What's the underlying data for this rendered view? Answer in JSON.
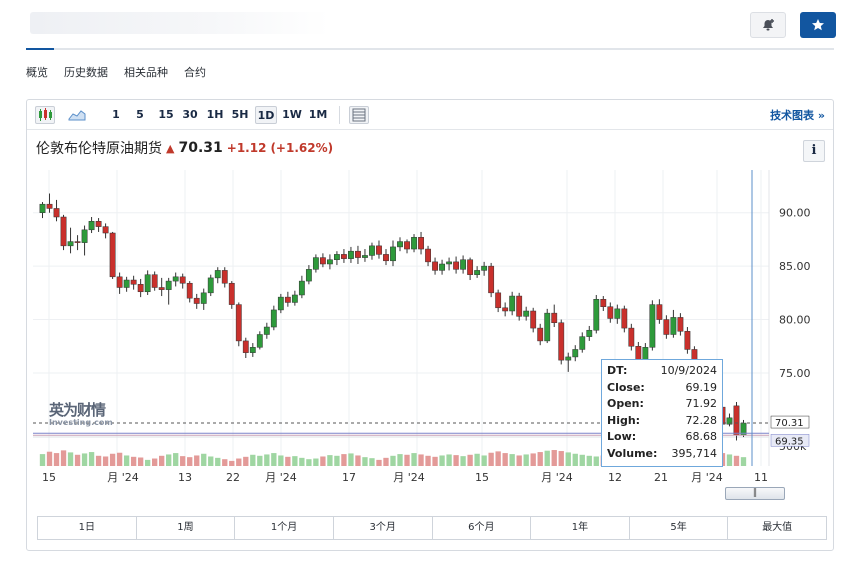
{
  "header": {
    "alert_icon": "bell-plus-icon",
    "star_icon": "star-icon"
  },
  "subnav": {
    "items": [
      "概览",
      "历史数据",
      "相关品种",
      "合约"
    ]
  },
  "toolbar": {
    "chart_type_icon": "candlestick-icon",
    "area_icon": "area-chart-icon",
    "intervals": [
      "1",
      "5",
      "15",
      "30",
      "1H",
      "5H",
      "1D",
      "1W",
      "1M"
    ],
    "selected_interval": "1D",
    "settings_icon": "grid-settings-icon",
    "tech_chart_label": "技术图表 »"
  },
  "instrument": {
    "name": "伦敦布伦特原油期货",
    "price": "70.31",
    "change": "+1.12",
    "change_pct": "(+1.62%)"
  },
  "info_button": "i",
  "logo": {
    "cn": "英为财情",
    "en": "Investing.com"
  },
  "tooltip": {
    "rows": [
      {
        "label": "DT:",
        "value": "10/9/2024"
      },
      {
        "label": "Close:",
        "value": "69.19"
      },
      {
        "label": "Open:",
        "value": "71.92"
      },
      {
        "label": "High:",
        "value": "72.28"
      },
      {
        "label": "Low:",
        "value": "68.68"
      },
      {
        "label": "Volume:",
        "value": "395,714"
      }
    ]
  },
  "range_buttons": [
    "1日",
    "1周",
    "1个月",
    "3个月",
    "6个月",
    "1年",
    "5年",
    "最大值"
  ],
  "colors": {
    "up": "#2e9a3b",
    "down": "#c9302c",
    "accent": "#1256a0"
  },
  "chart_data": {
    "type": "candlestick",
    "y_ticks": [
      "90.00",
      "85.00",
      "80.00",
      "75.00"
    ],
    "volume_tick": "500k",
    "last_price_label": "70.31",
    "ref_price_label": "69.35",
    "x_labels": [
      "15",
      "月 '24",
      "13",
      "22",
      "月 '24",
      "17",
      "月 '24",
      "15",
      "月 '24",
      "12",
      "21",
      "月 '24",
      "11"
    ],
    "ylim": [
      72,
      94
    ],
    "candles": [
      [
        90.0,
        90.8,
        91.0,
        89.5
      ],
      [
        90.8,
        90.4,
        91.8,
        90.0
      ],
      [
        90.4,
        89.6,
        91.2,
        89.2
      ],
      [
        89.6,
        86.9,
        89.8,
        86.5
      ],
      [
        86.9,
        87.3,
        88.6,
        86.2
      ],
      [
        87.3,
        87.2,
        87.9,
        86.5
      ],
      [
        87.2,
        88.4,
        88.8,
        86.0
      ],
      [
        88.4,
        89.2,
        89.6,
        88.1
      ],
      [
        89.2,
        88.7,
        89.5,
        88.2
      ],
      [
        88.7,
        88.1,
        89.0,
        87.6
      ],
      [
        88.1,
        84.0,
        88.2,
        83.8
      ],
      [
        84.0,
        83.0,
        84.4,
        82.4
      ],
      [
        83.0,
        83.7,
        84.0,
        82.6
      ],
      [
        83.7,
        83.3,
        84.1,
        82.8
      ],
      [
        83.3,
        82.6,
        83.8,
        82.1
      ],
      [
        82.6,
        84.2,
        84.6,
        82.3
      ],
      [
        84.2,
        83.0,
        84.5,
        82.7
      ],
      [
        83.0,
        82.8,
        83.9,
        82.2
      ],
      [
        82.8,
        83.6,
        83.9,
        81.4
      ],
      [
        83.6,
        84.0,
        84.4,
        83.1
      ],
      [
        84.0,
        83.4,
        84.3,
        82.9
      ],
      [
        83.4,
        82.0,
        83.6,
        81.6
      ],
      [
        82.0,
        81.5,
        82.4,
        81.0
      ],
      [
        81.5,
        82.5,
        82.9,
        80.9
      ],
      [
        82.5,
        83.9,
        84.2,
        82.2
      ],
      [
        83.9,
        84.6,
        84.9,
        83.4
      ],
      [
        84.6,
        83.4,
        84.9,
        83.0
      ],
      [
        83.4,
        81.4,
        83.6,
        81.0
      ],
      [
        81.4,
        78.0,
        81.6,
        77.5
      ],
      [
        78.0,
        76.9,
        78.3,
        76.4
      ],
      [
        76.9,
        77.4,
        77.8,
        76.5
      ],
      [
        77.4,
        78.6,
        78.9,
        77.2
      ],
      [
        78.6,
        79.3,
        79.7,
        78.2
      ],
      [
        79.3,
        80.9,
        81.3,
        79.0
      ],
      [
        80.9,
        82.1,
        82.4,
        80.6
      ],
      [
        82.1,
        81.6,
        82.6,
        81.2
      ],
      [
        81.6,
        82.3,
        82.7,
        81.3
      ],
      [
        82.3,
        83.6,
        84.1,
        82.0
      ],
      [
        83.6,
        84.7,
        85.1,
        83.3
      ],
      [
        84.7,
        85.8,
        86.1,
        84.4
      ],
      [
        85.8,
        85.2,
        86.2,
        84.9
      ],
      [
        85.2,
        85.6,
        86.1,
        84.7
      ],
      [
        85.6,
        86.1,
        86.4,
        85.1
      ],
      [
        86.1,
        85.7,
        86.6,
        85.3
      ],
      [
        85.7,
        86.4,
        86.8,
        85.3
      ],
      [
        86.4,
        85.8,
        86.9,
        85.2
      ],
      [
        85.8,
        86.0,
        86.6,
        85.4
      ],
      [
        86.0,
        86.9,
        87.2,
        85.6
      ],
      [
        86.9,
        86.1,
        87.4,
        85.7
      ],
      [
        86.1,
        85.5,
        86.6,
        85.1
      ],
      [
        85.5,
        86.8,
        87.4,
        85.0
      ],
      [
        86.8,
        87.3,
        87.7,
        86.4
      ],
      [
        87.3,
        86.6,
        87.5,
        86.2
      ],
      [
        86.6,
        87.7,
        88.0,
        86.3
      ],
      [
        87.7,
        86.6,
        88.2,
        86.1
      ],
      [
        86.6,
        85.4,
        86.9,
        85.0
      ],
      [
        85.4,
        84.6,
        85.8,
        84.2
      ],
      [
        84.6,
        85.2,
        85.6,
        84.2
      ],
      [
        85.2,
        85.4,
        85.8,
        84.6
      ],
      [
        85.4,
        84.7,
        85.9,
        84.3
      ],
      [
        84.7,
        85.6,
        86.0,
        84.3
      ],
      [
        85.6,
        84.2,
        85.8,
        83.7
      ],
      [
        84.2,
        84.6,
        85.0,
        83.9
      ],
      [
        84.6,
        85.0,
        85.4,
        84.1
      ],
      [
        85.0,
        82.5,
        85.3,
        82.1
      ],
      [
        82.5,
        81.1,
        82.8,
        80.7
      ],
      [
        81.1,
        80.8,
        81.6,
        80.3
      ],
      [
        80.8,
        82.2,
        82.6,
        80.4
      ],
      [
        82.2,
        80.3,
        82.5,
        79.9
      ],
      [
        80.3,
        80.8,
        81.2,
        79.9
      ],
      [
        80.8,
        79.2,
        81.1,
        78.8
      ],
      [
        79.2,
        78.0,
        79.6,
        77.6
      ],
      [
        78.0,
        80.6,
        81.0,
        77.8
      ],
      [
        80.6,
        79.7,
        81.4,
        79.3
      ],
      [
        79.7,
        76.2,
        80.0,
        75.8
      ],
      [
        76.2,
        76.5,
        76.9,
        75.1
      ],
      [
        76.5,
        77.2,
        77.6,
        76.1
      ],
      [
        77.2,
        78.4,
        78.8,
        76.9
      ],
      [
        78.4,
        79.0,
        79.4,
        78.0
      ],
      [
        79.0,
        81.9,
        82.3,
        78.7
      ],
      [
        81.9,
        81.2,
        82.2,
        80.8
      ],
      [
        81.2,
        80.1,
        81.6,
        79.7
      ],
      [
        80.1,
        81.0,
        81.4,
        79.6
      ],
      [
        81.0,
        79.2,
        81.3,
        78.8
      ],
      [
        79.2,
        77.5,
        79.6,
        77.1
      ],
      [
        77.5,
        76.2,
        77.9,
        75.8
      ],
      [
        76.2,
        77.4,
        77.8,
        75.9
      ],
      [
        77.4,
        81.4,
        81.8,
        77.1
      ],
      [
        81.4,
        80.0,
        81.9,
        79.6
      ],
      [
        80.0,
        78.6,
        80.4,
        78.2
      ],
      [
        78.6,
        80.2,
        80.9,
        78.3
      ],
      [
        80.2,
        78.9,
        80.6,
        78.5
      ],
      [
        78.9,
        77.2,
        79.3,
        76.8
      ],
      [
        77.2,
        74.2,
        77.5,
        73.8
      ],
      [
        74.2,
        72.4,
        74.6,
        72.0
      ],
      [
        72.4,
        73.9,
        74.2,
        72.1
      ],
      [
        73.9,
        71.8,
        74.3,
        71.4
      ],
      [
        71.8,
        70.2,
        72.1,
        69.8
      ],
      [
        70.2,
        70.8,
        71.2,
        70.0
      ],
      [
        71.92,
        69.19,
        72.28,
        68.68
      ],
      [
        69.19,
        70.31,
        70.6,
        69.0
      ]
    ],
    "volume": [
      0.35,
      0.42,
      0.38,
      0.46,
      0.4,
      0.33,
      0.37,
      0.41,
      0.3,
      0.28,
      0.36,
      0.39,
      0.31,
      0.27,
      0.25,
      0.18,
      0.22,
      0.3,
      0.34,
      0.38,
      0.29,
      0.26,
      0.31,
      0.36,
      0.28,
      0.24,
      0.2,
      0.15,
      0.22,
      0.27,
      0.33,
      0.3,
      0.34,
      0.38,
      0.31,
      0.27,
      0.29,
      0.24,
      0.2,
      0.22,
      0.28,
      0.32,
      0.3,
      0.35,
      0.37,
      0.31,
      0.26,
      0.23,
      0.18,
      0.24,
      0.3,
      0.35,
      0.33,
      0.38,
      0.34,
      0.3,
      0.27,
      0.31,
      0.34,
      0.32,
      0.29,
      0.33,
      0.36,
      0.31,
      0.39,
      0.43,
      0.38,
      0.35,
      0.31,
      0.34,
      0.37,
      0.41,
      0.45,
      0.47,
      0.44,
      0.4,
      0.36,
      0.33,
      0.3,
      0.28,
      0.31,
      0.35,
      0.38,
      0.42,
      0.4,
      0.37,
      0.34,
      0.31,
      0.36,
      0.39,
      0.42,
      0.45,
      0.48,
      0.44,
      0.4,
      0.46,
      0.42,
      0.38,
      0.34,
      0.3,
      0.26
    ]
  }
}
